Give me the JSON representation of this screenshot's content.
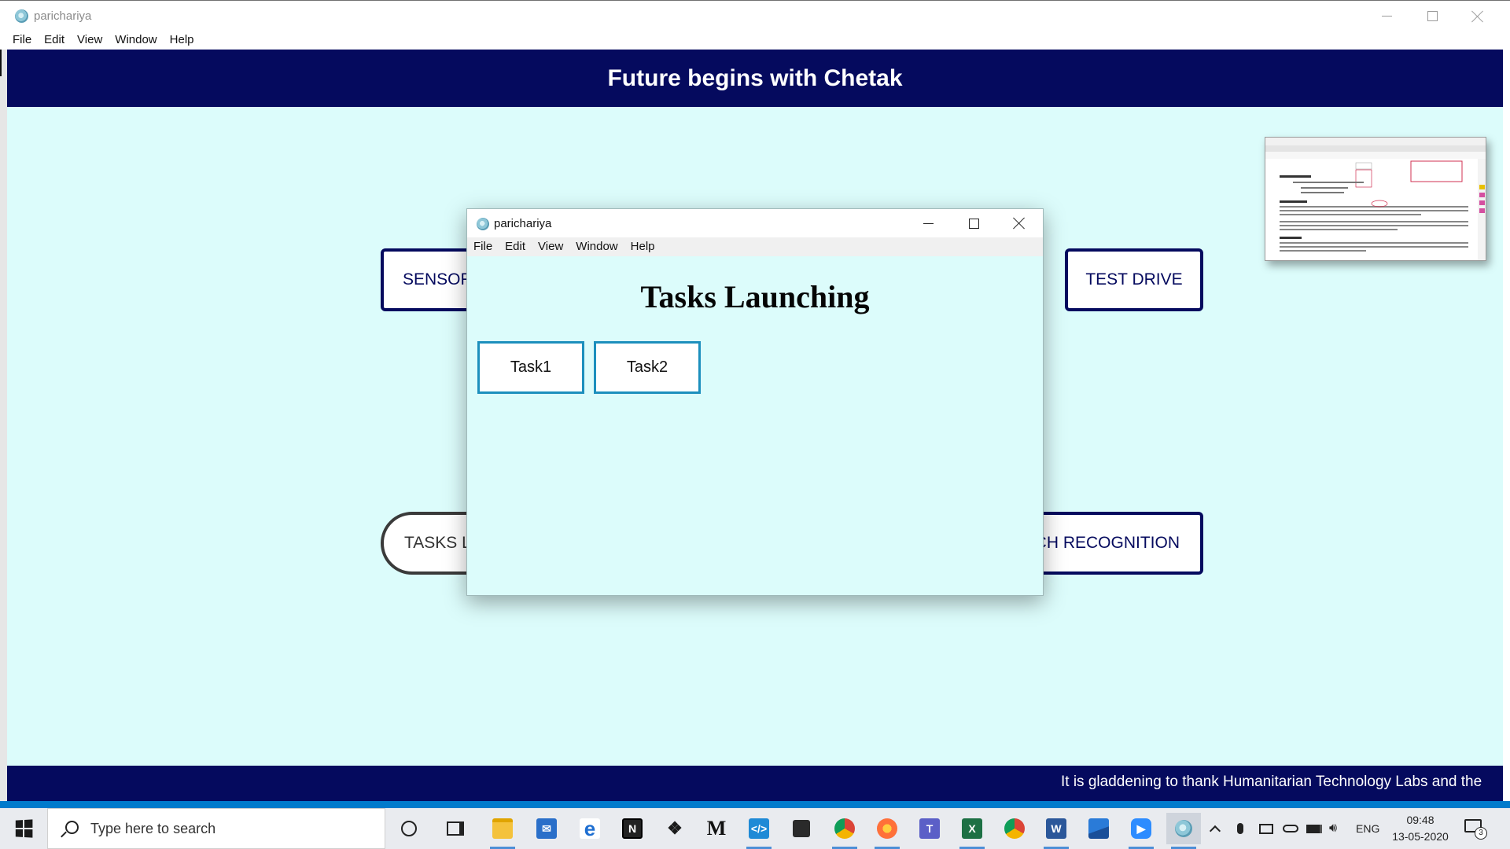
{
  "main_window": {
    "title": "paricha­riya",
    "menu": [
      "File",
      "Edit",
      "View",
      "Window",
      "Help"
    ]
  },
  "header": {
    "title": "Future begins with Chetak"
  },
  "nav_buttons": {
    "sensors": "SENSOR",
    "test_drive": "TEST DRIVE",
    "tasks": "TASKS L",
    "speech": "CH RECOGNITION"
  },
  "footer": {
    "marquee": "It is gladdening to thank Humanitarian Technology Labs and the"
  },
  "dialog": {
    "title": "parichariya",
    "menu": [
      "File",
      "Edit",
      "View",
      "Window",
      "Help"
    ],
    "heading": "Tasks Launching",
    "task_buttons": [
      "Task1",
      "Task2"
    ]
  },
  "taskbar": {
    "search_placeholder": "Type here to search",
    "apps": [
      "cortana-icon",
      "task-view-icon",
      "file-explorer-icon",
      "mail-icon",
      "edge-icon",
      "notion-icon",
      "dropbox-icon",
      "gmail-icon",
      "vscode-icon",
      "sticky-notes-icon",
      "chrome-icon",
      "firefox-icon",
      "teams-icon",
      "excel-icon",
      "chrome-profile-icon",
      "word-icon",
      "photos-icon",
      "zoom-icon",
      "electron-app-icon"
    ],
    "tray": {
      "language": "ENG",
      "time": "09:48",
      "date": "13-05-2020",
      "notifications": "3"
    }
  },
  "colors": {
    "header_bg": "#050a5e",
    "content_bg": "#dcfcfb",
    "task_border": "#1c8fbd",
    "status_strip": "#007acc"
  }
}
